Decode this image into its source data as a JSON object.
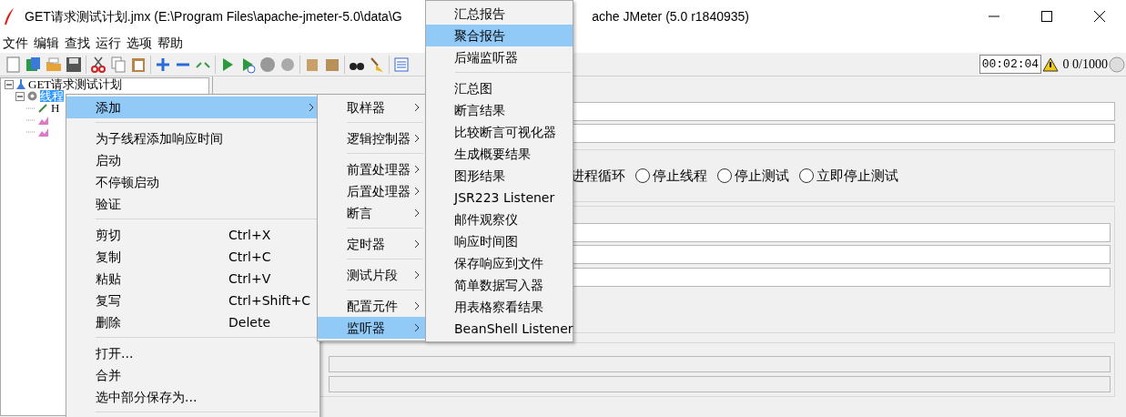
{
  "window": {
    "title_start": "GET请求测试计划.jmx (E:\\Program Files\\apache-jmeter-5.0\\data\\G",
    "title_end": "ache JMeter (5.0 r1840935)"
  },
  "menu_bar": [
    "文件",
    "编辑",
    "查找",
    "运行",
    "选项",
    "帮助"
  ],
  "status": {
    "timer": "00:02:04",
    "warnings": "0",
    "threads": "0/1000"
  },
  "tree": [
    {
      "label": "GET请求测试计划",
      "kind": "plan",
      "selected": false,
      "children": [
        {
          "label": "线程",
          "kind": "threadgroup",
          "selected": true,
          "children": [
            {
              "label": "H",
              "kind": "sampler",
              "selected": false
            },
            {
              "kind": "listener",
              "selected": false
            },
            {
              "kind": "listener",
              "selected": false
            }
          ]
        }
      ]
    }
  ],
  "editor": {
    "action_fragment": "进程循环",
    "error_actions": [
      {
        "label": "停止线程",
        "selected": false
      },
      {
        "label": "停止测试",
        "selected": false
      },
      {
        "label": "立即停止测试",
        "selected": false
      }
    ]
  },
  "context_menu": {
    "items": [
      {
        "kind": "item",
        "label": "添加",
        "submenu": true,
        "selected": true
      },
      {
        "kind": "separator"
      },
      {
        "kind": "item",
        "label": "为子线程添加响应时间",
        "selected": false
      },
      {
        "kind": "item",
        "label": "启动",
        "selected": false
      },
      {
        "kind": "item",
        "label": "不停顿启动",
        "selected": false
      },
      {
        "kind": "item",
        "label": "验证",
        "selected": false
      },
      {
        "kind": "separator"
      },
      {
        "kind": "item",
        "label": "剪切",
        "shortcut": "Ctrl+X",
        "selected": false
      },
      {
        "kind": "item",
        "label": "复制",
        "shortcut": "Ctrl+C",
        "selected": false
      },
      {
        "kind": "item",
        "label": "粘贴",
        "shortcut": "Ctrl+V",
        "selected": false
      },
      {
        "kind": "item",
        "label": "复写",
        "shortcut": "Ctrl+Shift+C",
        "selected": false
      },
      {
        "kind": "item",
        "label": "删除",
        "shortcut": "Delete",
        "selected": false
      },
      {
        "kind": "separator"
      },
      {
        "kind": "item",
        "label": "打开...",
        "selected": false
      },
      {
        "kind": "item",
        "label": "合并",
        "selected": false
      },
      {
        "kind": "item",
        "label": "选中部分保存为...",
        "selected": false
      },
      {
        "kind": "separator"
      }
    ]
  },
  "add_submenu": {
    "items": [
      {
        "kind": "item",
        "label": "取样器",
        "submenu": true,
        "selected": false
      },
      {
        "kind": "separator"
      },
      {
        "kind": "item",
        "label": "逻辑控制器",
        "submenu": true,
        "selected": false
      },
      {
        "kind": "separator"
      },
      {
        "kind": "item",
        "label": "前置处理器",
        "submenu": true,
        "selected": false
      },
      {
        "kind": "item",
        "label": "后置处理器",
        "submenu": true,
        "selected": false
      },
      {
        "kind": "item",
        "label": "断言",
        "submenu": true,
        "selected": false
      },
      {
        "kind": "separator"
      },
      {
        "kind": "item",
        "label": "定时器",
        "submenu": true,
        "selected": false
      },
      {
        "kind": "separator"
      },
      {
        "kind": "item",
        "label": "测试片段",
        "submenu": true,
        "selected": false
      },
      {
        "kind": "separator"
      },
      {
        "kind": "item",
        "label": "配置元件",
        "submenu": true,
        "selected": false
      },
      {
        "kind": "item",
        "label": "监听器",
        "submenu": true,
        "selected": true
      }
    ]
  },
  "listener_submenu": {
    "items": [
      {
        "kind": "item",
        "label": "汇总报告",
        "selected": false
      },
      {
        "kind": "item",
        "label": "聚合报告",
        "selected": true
      },
      {
        "kind": "item",
        "label": "后端监听器",
        "selected": false
      },
      {
        "kind": "separator"
      },
      {
        "kind": "item",
        "label": "汇总图",
        "selected": false
      },
      {
        "kind": "item",
        "label": "断言结果",
        "selected": false
      },
      {
        "kind": "item",
        "label": "比较断言可视化器",
        "selected": false
      },
      {
        "kind": "item",
        "label": "生成概要结果",
        "selected": false
      },
      {
        "kind": "item",
        "label": "图形结果",
        "selected": false
      },
      {
        "kind": "item",
        "label": "JSR223 Listener",
        "selected": false
      },
      {
        "kind": "item",
        "label": "邮件观察仪",
        "selected": false
      },
      {
        "kind": "item",
        "label": "响应时间图",
        "selected": false
      },
      {
        "kind": "item",
        "label": "保存响应到文件",
        "selected": false
      },
      {
        "kind": "item",
        "label": "简单数据写入器",
        "selected": false
      },
      {
        "kind": "item",
        "label": "用表格察看结果",
        "selected": false
      },
      {
        "kind": "item",
        "label": "BeanShell Listener",
        "selected": false
      }
    ]
  }
}
